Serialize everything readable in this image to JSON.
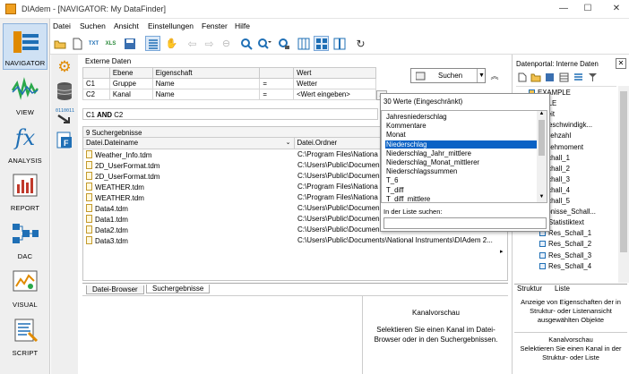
{
  "window": {
    "title": "DIAdem - [NAVIGATOR:  My DataFinder]",
    "minimize": "—",
    "maximize": "☐",
    "close": "✕"
  },
  "menu": [
    "Datei",
    "Suchen",
    "Ansicht",
    "Einstellungen",
    "Fenster",
    "Hilfe"
  ],
  "toolbar": {
    "txt_label": "TXT",
    "xls_label": "XLS"
  },
  "nav": [
    {
      "label": "NAVIGATOR",
      "icon": "navigator-icon"
    },
    {
      "label": "VIEW",
      "icon": "view-icon"
    },
    {
      "label": "ANALYSIS",
      "icon": "analysis-icon"
    },
    {
      "label": "REPORT",
      "icon": "report-icon"
    },
    {
      "label": "DAC",
      "icon": "dac-icon"
    },
    {
      "label": "VISUAL",
      "icon": "visual-icon"
    },
    {
      "label": "SCRIPT",
      "icon": "script-icon"
    }
  ],
  "nav_fx": "fx",
  "search": {
    "section_title": "Externe Daten",
    "columns": [
      "",
      "Ebene",
      "Eigenschaft",
      "",
      "Wert"
    ],
    "rows": [
      {
        "id": "C1",
        "ebene": "Gruppe",
        "eigenschaft": "Name",
        "op": "=",
        "wert": "Wetter"
      },
      {
        "id": "C2",
        "ebene": "Kanal",
        "eigenschaft": "Name",
        "op": "=",
        "wert": "<Wert eingeben>"
      }
    ],
    "ellipsis": "...",
    "button": "Suchen",
    "condition_prefix": "C1",
    "condition_and": "AND",
    "condition_suffix": "C2"
  },
  "results": {
    "count_label": "9 Suchergebnisse",
    "columns": [
      "Datei.Dateiname",
      "Datei.Ordner"
    ],
    "files": [
      {
        "name": "Weather_Info.tdm",
        "folder": "C:\\Program Files\\Nationa"
      },
      {
        "name": "2D_UserFormat.tdm",
        "folder": "C:\\Users\\Public\\Documen"
      },
      {
        "name": "2D_UserFormat.tdm",
        "folder": "C:\\Users\\Public\\Documen"
      },
      {
        "name": "WEATHER.tdm",
        "folder": "C:\\Program Files\\Nationa"
      },
      {
        "name": "WEATHER.tdm",
        "folder": "C:\\Program Files\\Nationa"
      },
      {
        "name": "Data4.tdm",
        "folder": "C:\\Users\\Public\\Documen"
      },
      {
        "name": "Data1.tdm",
        "folder": "C:\\Users\\Public\\Documen"
      },
      {
        "name": "Data2.tdm",
        "folder": "C:\\Users\\Public\\Documen"
      },
      {
        "name": "Data3.tdm",
        "folder": "C:\\Users\\Public\\Documents\\National Instruments\\DIAdem 2..."
      }
    ],
    "tabs": [
      "Datei-Browser",
      "Suchergebnisse"
    ]
  },
  "preview": {
    "title": "Kanalvorschau",
    "text": "Selektieren Sie einen Kanal im Datei-Browser oder in den Suchergebnissen."
  },
  "popup": {
    "header": "30 Werte (Eingeschränkt)",
    "options": [
      "Jahresniederschlag",
      "Kommentare",
      "Monat",
      "Niederschlag",
      "Niederschlag_Jahr_mittlere",
      "Niederschlag_Monat_mittlerer",
      "Niederschlagssummen",
      "T_6",
      "T_diff",
      "T_diff_mittlere"
    ],
    "selected_index": 3,
    "search_label": "In der Liste suchen:",
    "search_value": ""
  },
  "datenportal": {
    "title": "Datenportal: Interne Daten",
    "close": "✕",
    "tree": [
      "EXAMPLE",
      "MPLE",
      "Zeit",
      "Geschwindigk...",
      "Drehzahl",
      "Drehmoment",
      "Schall_1",
      "Schall_2",
      "Schall_3",
      "Schall_4",
      "Schall_5",
      "ebnisse_Schall...",
      "Statistiktext",
      "Res_Schall_1",
      "Res_Schall_2",
      "Res_Schall_3",
      "Res_Schall_4"
    ],
    "tabs": [
      "Struktur",
      "Liste"
    ],
    "info": "Anzeige von Eigenschaften der in Struktur- oder Listenansicht ausgewählten Objekte",
    "preview_title": "Kanalvorschau",
    "preview_text": "Selektieren Sie einen Kanal in der Struktur- oder Liste"
  },
  "colors": {
    "accent": "#0a62c5",
    "nav_active": "#cfe1f4",
    "icon_orange": "#e08a00",
    "icon_blue": "#1f6fb5"
  }
}
